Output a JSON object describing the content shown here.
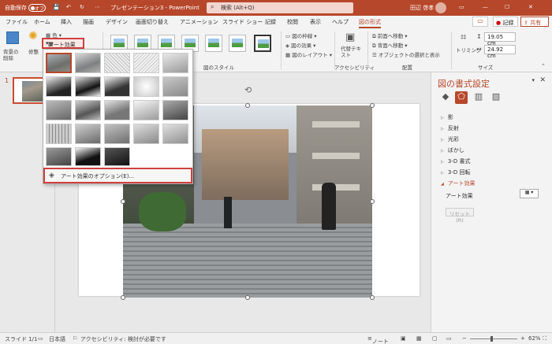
{
  "titlebar": {
    "autosave": "自動保存",
    "autosave_state": "オフ",
    "doc_title": "プレゼンテーション3 - PowerPoint",
    "search_placeholder": "検索 (Alt+Q)",
    "user": "田辺 啓孝"
  },
  "tabs": [
    "ファイル",
    "ホーム",
    "挿入",
    "描画",
    "デザイン",
    "画面切り替え",
    "アニメーション",
    "スライド ショー",
    "記録",
    "校閲",
    "表示",
    "ヘルプ",
    "図の形式"
  ],
  "active_tab": "図の形式",
  "actions": {
    "record": "記録",
    "share": "共有"
  },
  "ribbon": {
    "remove_bg": "背景の削除",
    "correct": "修整",
    "color": "色",
    "art_effects": "アート効果",
    "styles_group": "図のスタイル",
    "border": "図の枠線",
    "effects": "図の効果",
    "layout": "図のレイアウト",
    "alt_text": "代替テキスト",
    "accessibility_group": "アクセシビリティ",
    "bring_forward": "前面へ移動",
    "send_backward": "背面へ移動",
    "selection_pane": "オブジェクトの選択と表示",
    "arrange_group": "配置",
    "crop": "トリミング",
    "height": "19.05 cm",
    "width": "24.92 cm",
    "size_group": "サイズ"
  },
  "slide_number": "1",
  "dropdown": {
    "options_label": "アート効果のオプション(E)..."
  },
  "taskpane": {
    "title": "図の書式設定",
    "items": [
      "影",
      "反射",
      "光彩",
      "ぼかし",
      "3-D 書式",
      "3-D 回転",
      "アート効果"
    ],
    "open_item": "アート効果",
    "sub_label": "アート効果",
    "reset": "リセット(R)"
  },
  "status": {
    "slide": "スライド 1/1",
    "language": "日本語",
    "accessibility": "アクセシビリティ: 検討が必要です",
    "notes": "ノート",
    "zoom": "62%"
  },
  "colors": {
    "accent": "#b7472a",
    "highlight_box": "#d04040"
  }
}
